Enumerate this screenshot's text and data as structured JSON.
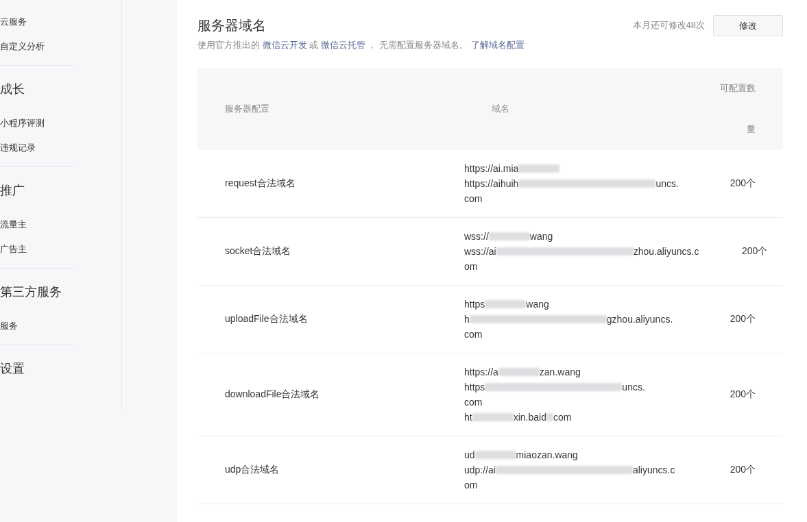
{
  "sidebar": {
    "sections": [
      {
        "items": [
          "云服务",
          "自定义分析"
        ]
      },
      {
        "title": "成长",
        "items": [
          "小程序评测",
          "违规记录"
        ]
      },
      {
        "title": "推广",
        "items": [
          "流量主",
          "广告主"
        ]
      },
      {
        "title": "第三方服务",
        "items": [
          "服务"
        ]
      },
      {
        "title": "设置"
      }
    ]
  },
  "section": {
    "title": "服务器域名",
    "quota": "本月还可修改48次",
    "edit_button": "修改",
    "description": [
      {
        "kind": "text",
        "text": "使用官方推出的 "
      },
      {
        "kind": "link",
        "text": "微信云开发"
      },
      {
        "kind": "text",
        "text": " 或 "
      },
      {
        "kind": "link",
        "text": "微信云托管"
      },
      {
        "kind": "text",
        "text": " ， 无需配置服务器域名。 "
      },
      {
        "kind": "link",
        "text": "了解域名配置"
      }
    ]
  },
  "table": {
    "columns": [
      "服务器配置",
      "域名",
      "可配置数量"
    ],
    "rows": [
      {
        "name": "request合法域名",
        "count": "200个",
        "lines": [
          [
            {
              "kind": "text",
              "text": "https://ai.mia"
            },
            {
              "kind": "blur"
            }
          ],
          [
            {
              "kind": "text",
              "text": "https://aihuih"
            },
            {
              "kind": "blur_long"
            },
            {
              "kind": "text",
              "text": "uncs."
            }
          ],
          [
            {
              "kind": "text",
              "text": "com"
            }
          ]
        ]
      },
      {
        "name": "socket合法域名",
        "count": "200个",
        "lines": [
          [
            {
              "kind": "text",
              "text": "wss://"
            },
            {
              "kind": "blur"
            },
            {
              "kind": "text",
              "text": "wang"
            }
          ],
          [
            {
              "kind": "text",
              "text": "wss://ai"
            },
            {
              "kind": "blur_long"
            },
            {
              "kind": "text",
              "text": "zhou.aliyuncs.c"
            }
          ],
          [
            {
              "kind": "text",
              "text": "om"
            }
          ]
        ]
      },
      {
        "name": "uploadFile合法域名",
        "count": "200个",
        "lines": [
          [
            {
              "kind": "text",
              "text": "https"
            },
            {
              "kind": "blur"
            },
            {
              "kind": "text",
              "text": "wang"
            }
          ],
          [
            {
              "kind": "text",
              "text": "h"
            },
            {
              "kind": "blur_long"
            },
            {
              "kind": "text",
              "text": "gzhou.aliyuncs."
            }
          ],
          [
            {
              "kind": "text",
              "text": "com"
            }
          ]
        ]
      },
      {
        "name": "downloadFile合法域名",
        "count": "200个",
        "lines": [
          [
            {
              "kind": "text",
              "text": "https://a"
            },
            {
              "kind": "blur"
            },
            {
              "kind": "text",
              "text": "zan.wang"
            }
          ],
          [
            {
              "kind": "text",
              "text": "https"
            },
            {
              "kind": "blur_long"
            },
            {
              "kind": "text",
              "text": "uncs."
            }
          ],
          [
            {
              "kind": "text",
              "text": "com"
            }
          ],
          [
            {
              "kind": "text",
              "text": "ht"
            },
            {
              "kind": "blur"
            },
            {
              "kind": "text",
              "text": "xin.baid"
            },
            {
              "kind": "blur_tiny"
            },
            {
              "kind": "text",
              "text": "com"
            }
          ]
        ]
      },
      {
        "name": "udp合法域名",
        "count": "200个",
        "lines": [
          [
            {
              "kind": "text",
              "text": "ud"
            },
            {
              "kind": "blur"
            },
            {
              "kind": "text",
              "text": "miaozan.wang"
            }
          ],
          [
            {
              "kind": "text",
              "text": "udp://ai"
            },
            {
              "kind": "blur_long"
            },
            {
              "kind": "text",
              "text": "aliyuncs.c"
            }
          ],
          [
            {
              "kind": "text",
              "text": "om"
            }
          ]
        ]
      }
    ]
  }
}
